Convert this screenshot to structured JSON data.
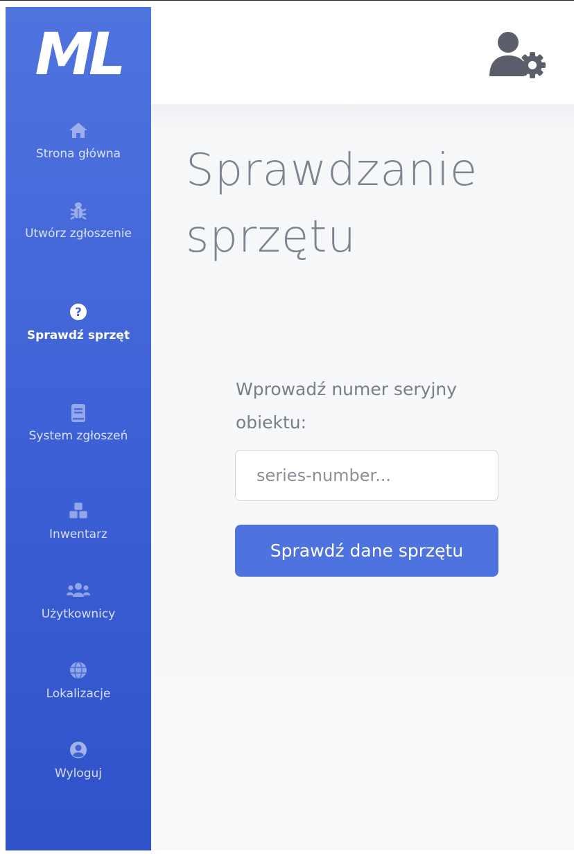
{
  "brand": {
    "logo_text": "ML"
  },
  "sidebar": {
    "items": [
      {
        "label": "Strona główna",
        "icon": "home-icon"
      },
      {
        "label": "Utwórz zgłoszenie",
        "icon": "bug-icon"
      },
      {
        "label": "Sprawdź sprzęt",
        "icon": "question-circle-icon",
        "active": true
      },
      {
        "label": "System zgłoszeń",
        "icon": "book-icon"
      },
      {
        "label": "Inwentarz",
        "icon": "cubes-icon"
      },
      {
        "label": "Użytkownicy",
        "icon": "users-icon"
      },
      {
        "label": "Lokalizacje",
        "icon": "globe-icon"
      },
      {
        "label": "Wyloguj",
        "icon": "user-circle-icon"
      }
    ]
  },
  "topbar": {
    "user_menu_icon": "user-cog-icon"
  },
  "main": {
    "title": "Sprawdzanie sprzętu",
    "form": {
      "label": "Wprowadź numer seryjny obiektu:",
      "serial_placeholder": "series-number...",
      "serial_value": "",
      "submit_label": "Sprawdź dane sprzętu"
    }
  },
  "colors": {
    "sidebar_top": "#4f74de",
    "sidebar_bottom": "#2f52c8",
    "primary_button": "#4e73df",
    "title_text": "#7f8290",
    "background": "#f8f9fb"
  }
}
